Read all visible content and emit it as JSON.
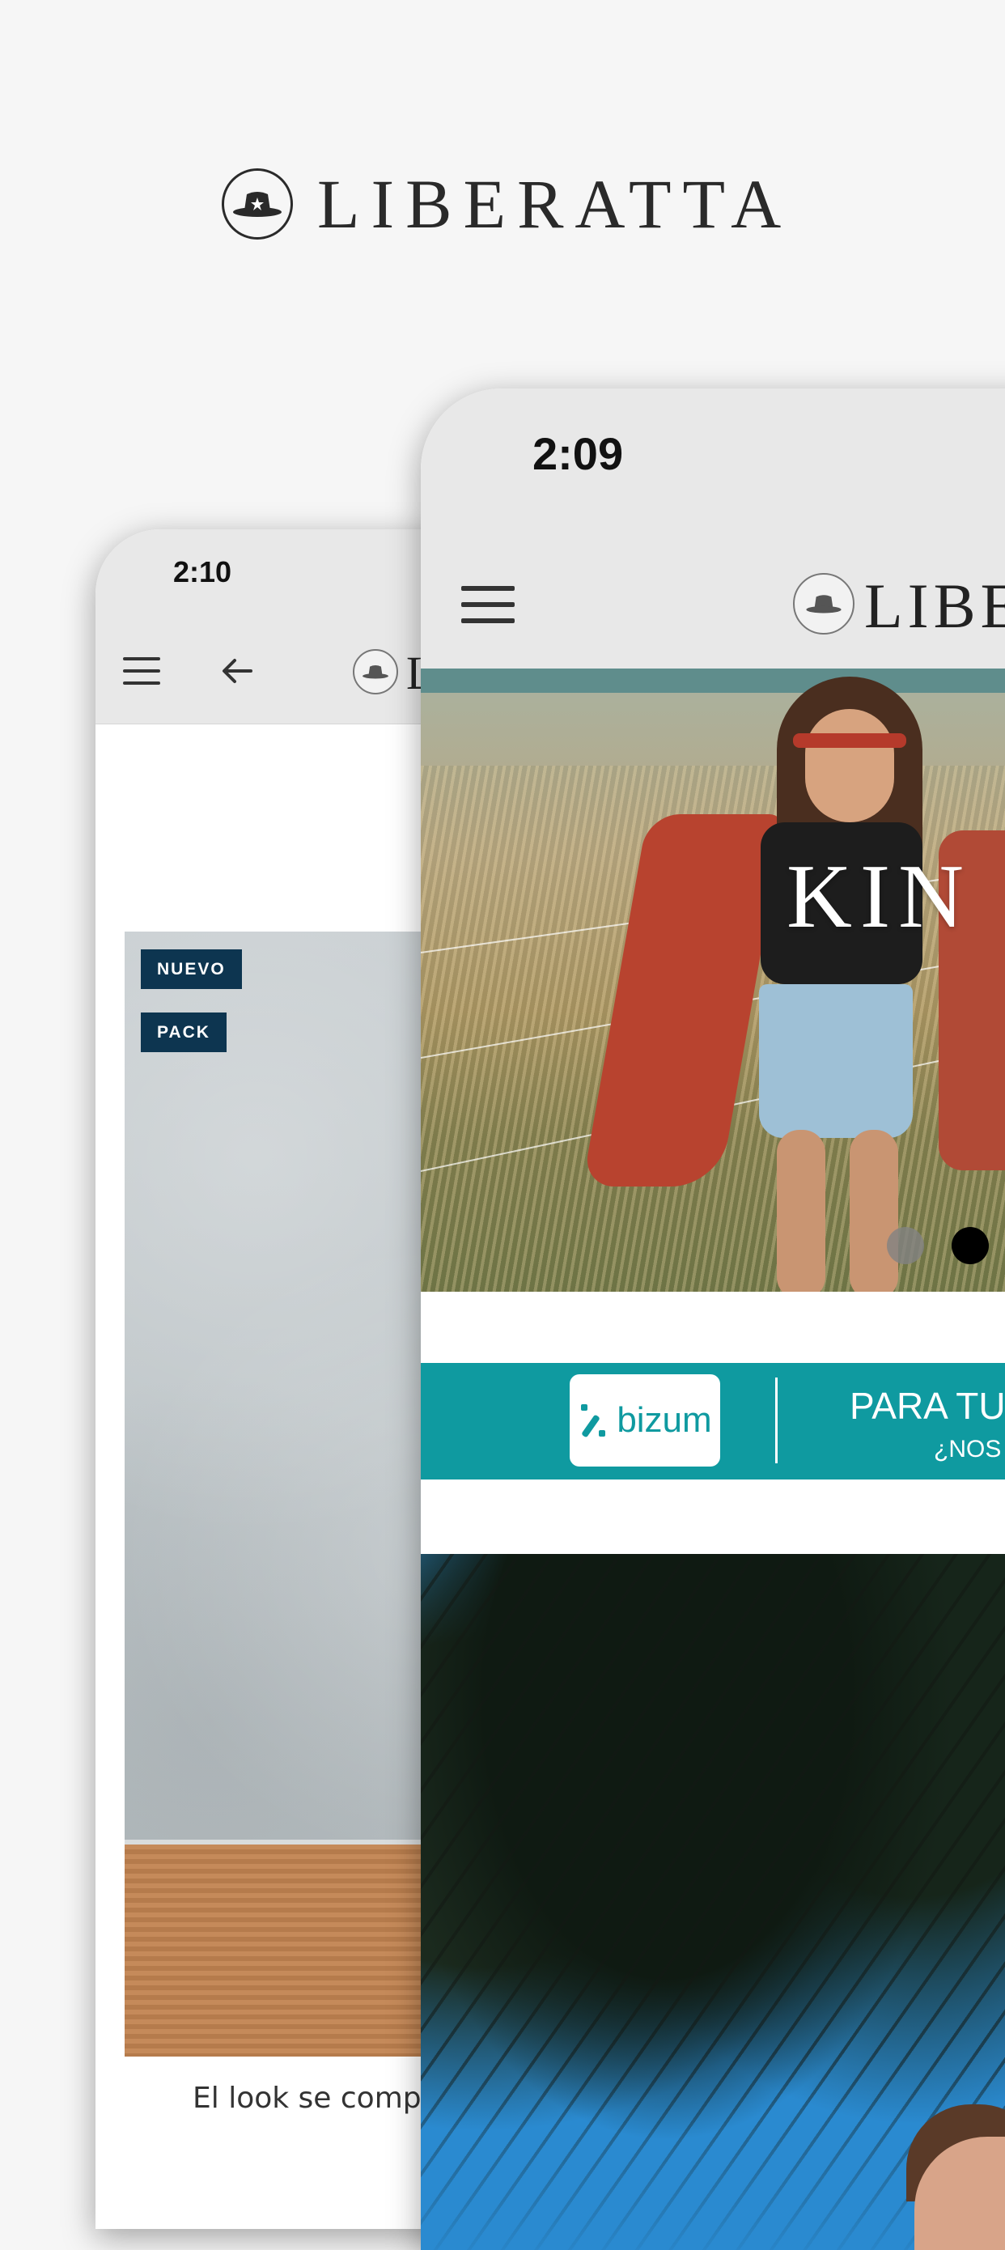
{
  "brand": {
    "name": "LIBERATTA",
    "logo_icon": "hat-star-icon"
  },
  "back_phone": {
    "status_time": "2:10",
    "nav": {
      "menu_icon": "hamburger-menu-icon",
      "back_icon": "arrow-left-icon",
      "logo_icon": "hat-logo-icon",
      "brand_partial": "L"
    },
    "product": {
      "badges": [
        "NUEVO",
        "PACK"
      ],
      "caption": "El look se compor"
    }
  },
  "front_phone": {
    "status_time": "2:09",
    "nav": {
      "menu_icon": "hamburger-menu-icon",
      "logo_icon": "hat-logo-icon",
      "brand_partial": "LIBE"
    },
    "hero": {
      "title": "KIN",
      "carousel_dots": 2,
      "active_dot": 1
    },
    "banner": {
      "logo_text": "bizum",
      "line1": "PARA TU",
      "line2": "¿NOS",
      "accent_color": "#0f9aa0"
    }
  }
}
